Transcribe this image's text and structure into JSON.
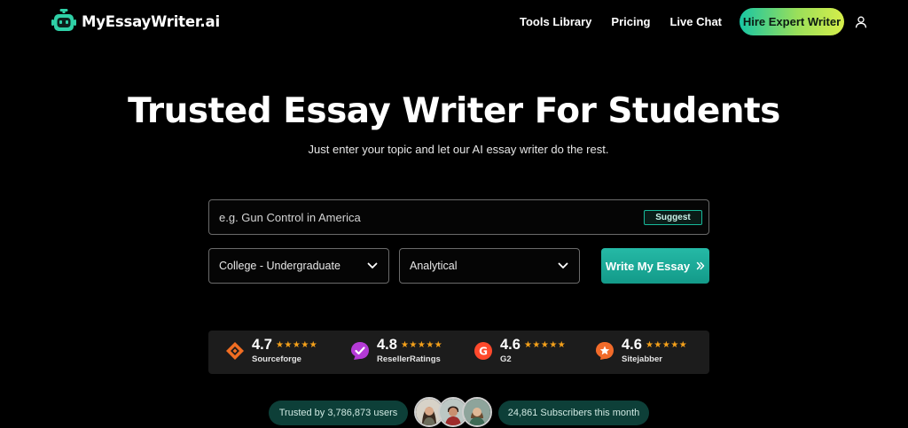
{
  "brand": {
    "name": "MyEssayWriter.ai",
    "icon": "robot-logo-icon",
    "accent": "#17b99a"
  },
  "nav": {
    "links": [
      "Tools Library",
      "Pricing",
      "Live Chat"
    ],
    "cta": "Hire Expert Writer",
    "user_icon": "user-icon"
  },
  "hero": {
    "title": "Trusted Essay Writer For Students",
    "subtitle": "Just enter your topic and let our AI essay writer do the rest."
  },
  "form": {
    "topic_placeholder": "e.g. Gun Control in America",
    "suggest_label": "Suggest",
    "level_value": "College - Undergraduate",
    "type_value": "Analytical",
    "submit_label": "Write My Essay",
    "submit_icon": "double-chevron-right-icon"
  },
  "ratings": [
    {
      "score": "4.7",
      "stars": "★★★★★",
      "site": "Sourceforge",
      "icon": "sourceforge-icon",
      "color": "#f06d22"
    },
    {
      "score": "4.8",
      "stars": "★★★★★",
      "site": "ResellerRatings",
      "icon": "resellerratings-icon",
      "color": "#b43ad6"
    },
    {
      "score": "4.6",
      "stars": "★★★★★",
      "site": "G2",
      "icon": "g2-icon",
      "color": "#ff492c"
    },
    {
      "score": "4.6",
      "stars": "★★★★★",
      "site": "Sitejabber",
      "icon": "sitejabber-icon",
      "color": "#f26b2a"
    }
  ],
  "trust": {
    "users_text": "Trusted by 3,786,873 users",
    "subscribers_text": "24,861 Subscribers this month"
  }
}
